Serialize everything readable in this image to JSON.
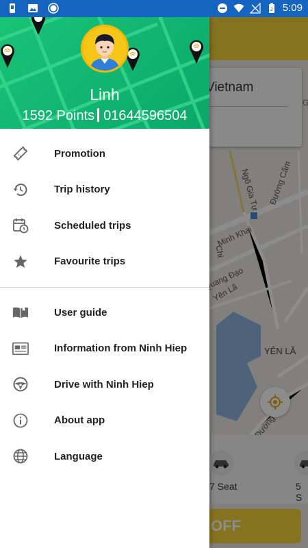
{
  "status_bar": {
    "time": "5:09",
    "icons_left": [
      "notification-icon",
      "image-icon",
      "record-icon"
    ],
    "icons_right": [
      "dnd-icon",
      "wifi-icon",
      "no-signal-icon",
      "battery-icon"
    ]
  },
  "drawer": {
    "user": {
      "name": "Linh",
      "points": "1592 Points",
      "phone": "01644596504"
    },
    "primary_items": [
      {
        "label": "Promotion",
        "icon": "ticket-icon"
      },
      {
        "label": "Trip history",
        "icon": "history-icon"
      },
      {
        "label": "Scheduled trips",
        "icon": "calendar-clock-icon"
      },
      {
        "label": "Favourite trips",
        "icon": "star-icon"
      }
    ],
    "secondary_items": [
      {
        "label": "User guide",
        "icon": "book-icon"
      },
      {
        "label": "Information from Ninh Hiep",
        "icon": "newspaper-icon"
      },
      {
        "label": "Drive with Ninh Hiep",
        "icon": "steering-wheel-icon"
      },
      {
        "label": "About app",
        "icon": "info-icon"
      },
      {
        "label": "Language",
        "icon": "globe-icon"
      }
    ]
  },
  "background_app": {
    "location_card_text": "Vietnam",
    "map_labels": [
      "Ngõ Gia Tự",
      "Đường Cấm",
      "Minh Khai",
      "Quang Đạo",
      "Yên Lã",
      "YÊN LÃ",
      "Đường",
      "Chi",
      "G"
    ],
    "vehicle_options": [
      "7 Seat",
      "5 S"
    ],
    "action_button": "OFF"
  },
  "colors": {
    "status_bar": "#1565c0",
    "drawer_header": "#19c377",
    "accent_yellow": "#f4d23a"
  }
}
